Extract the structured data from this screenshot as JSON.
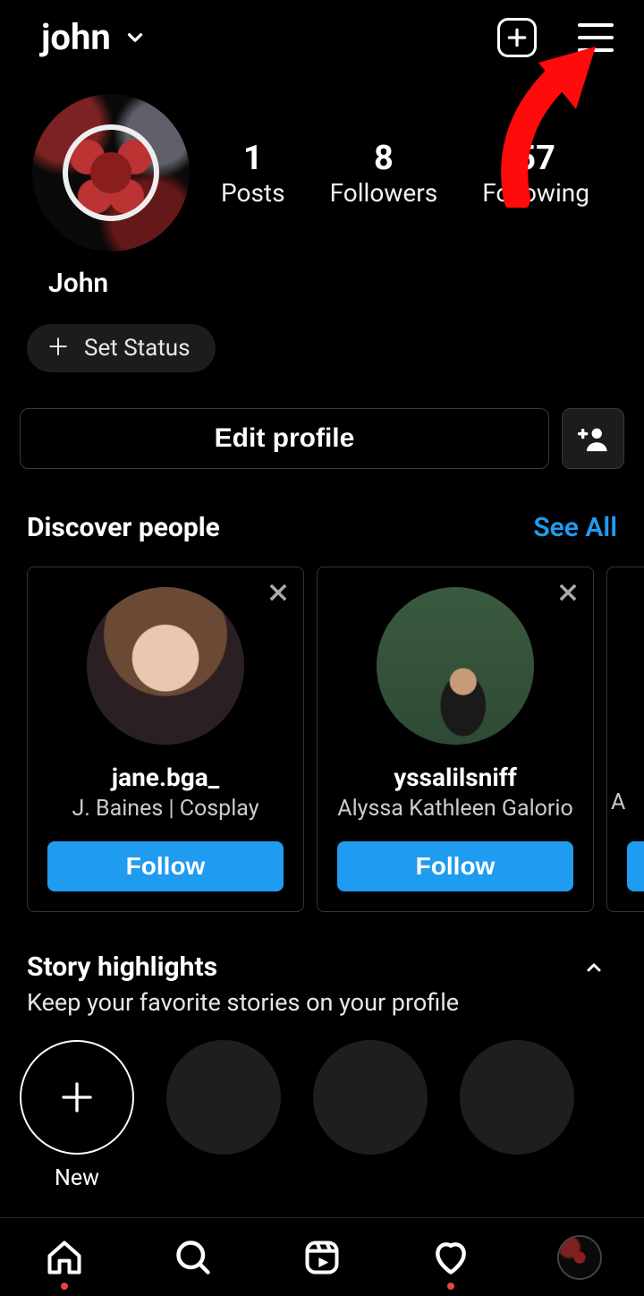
{
  "header": {
    "username": "john"
  },
  "profile": {
    "display_name": "John",
    "stats": {
      "posts": {
        "count": "1",
        "label": "Posts"
      },
      "followers": {
        "count": "8",
        "label": "Followers"
      },
      "following": {
        "count": "57",
        "label": "Following"
      }
    },
    "set_status_label": "Set Status",
    "edit_profile_label": "Edit profile"
  },
  "discover": {
    "title": "Discover people",
    "see_all_label": "See All",
    "follow_label": "Follow",
    "people": [
      {
        "username": "jane.bga_",
        "subtitle": "J. Baines | Cosplay"
      },
      {
        "username": "yssalilsniff",
        "subtitle": "Alyssa Kathleen Galorio"
      },
      {
        "username": "",
        "subtitle": "A"
      }
    ]
  },
  "highlights": {
    "title": "Story highlights",
    "subtitle": "Keep your favorite stories on your profile",
    "new_label": "New"
  }
}
